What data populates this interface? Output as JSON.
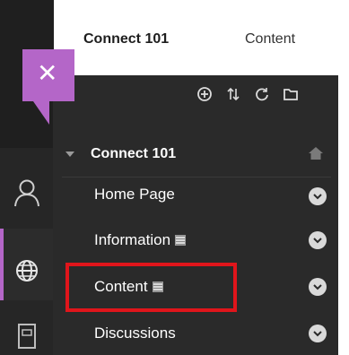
{
  "header": {
    "course_title": "Connect 101",
    "tab_label": "Content"
  },
  "menu": {
    "title": "Connect 101",
    "toolbar": [
      "add-icon",
      "reorder-icon",
      "refresh-icon",
      "folder-icon"
    ],
    "items": [
      {
        "label": "Home Page"
      },
      {
        "label": "Information"
      },
      {
        "label": "Content"
      },
      {
        "label": "Discussions"
      }
    ]
  },
  "close_tab": {
    "symbol": "✕",
    "color": "#b466c8"
  },
  "highlight_color": "#e0151b",
  "rail_icons": [
    "user-icon",
    "globe-icon",
    "book-icon"
  ]
}
